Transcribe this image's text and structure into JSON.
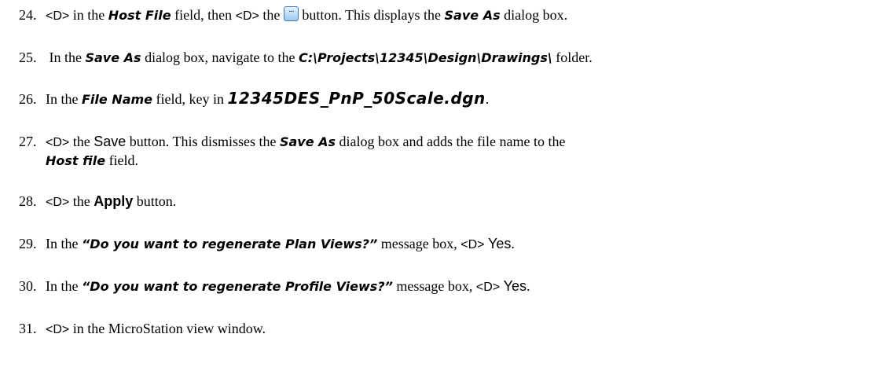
{
  "steps": [
    {
      "num": "24.",
      "t1": "<D>",
      "t2": " in the ",
      "t3": "Host File",
      "t4": " field, then ",
      "t5": "<D>",
      "t6": " the ",
      "button_icon": "ellipsis-browse-icon",
      "t7": " button. This displays the ",
      "t8": "Save As",
      "t9": " dialog box."
    },
    {
      "num": "25.",
      "t1": " In the ",
      "t2": "Save As",
      "t3": " dialog box, navigate to the ",
      "t4": "C:\\Projects\\12345\\Design\\Drawings\\",
      "t5": " folder."
    },
    {
      "num": "26.",
      "t1": "In the ",
      "t2": "File Name",
      "t3": " field, key in ",
      "t4": "12345DES_PnP_50Scale.dgn",
      "t5": "."
    },
    {
      "num": "27.",
      "t1": "<D>",
      "t2": " the ",
      "t3": "Save",
      "t4": " button. This dismisses the ",
      "t5": "Save As",
      "t6": " dialog box and adds the file name to the",
      "t7": "Host file",
      "t8": " field."
    },
    {
      "num": "28.",
      "t1": "<D>",
      "t2": " the ",
      "t3": "Apply",
      "t4": " button."
    },
    {
      "num": "29.",
      "t1": "In the ",
      "t2": "“Do you want to regenerate Plan Views?”",
      "t3": " message box, ",
      "t4": "<D>",
      "t5": " ",
      "t6": "Yes",
      "t7": "."
    },
    {
      "num": "30.",
      "t1": "In the ",
      "t2": "“Do you want to regenerate Profile Views?”",
      "t3": " message box, ",
      "t4": "<D>",
      "t5": " ",
      "t6": "Yes",
      "t7": "."
    },
    {
      "num": "31.",
      "t1": "<D>",
      "t2": " in the MicroStation view window."
    }
  ]
}
